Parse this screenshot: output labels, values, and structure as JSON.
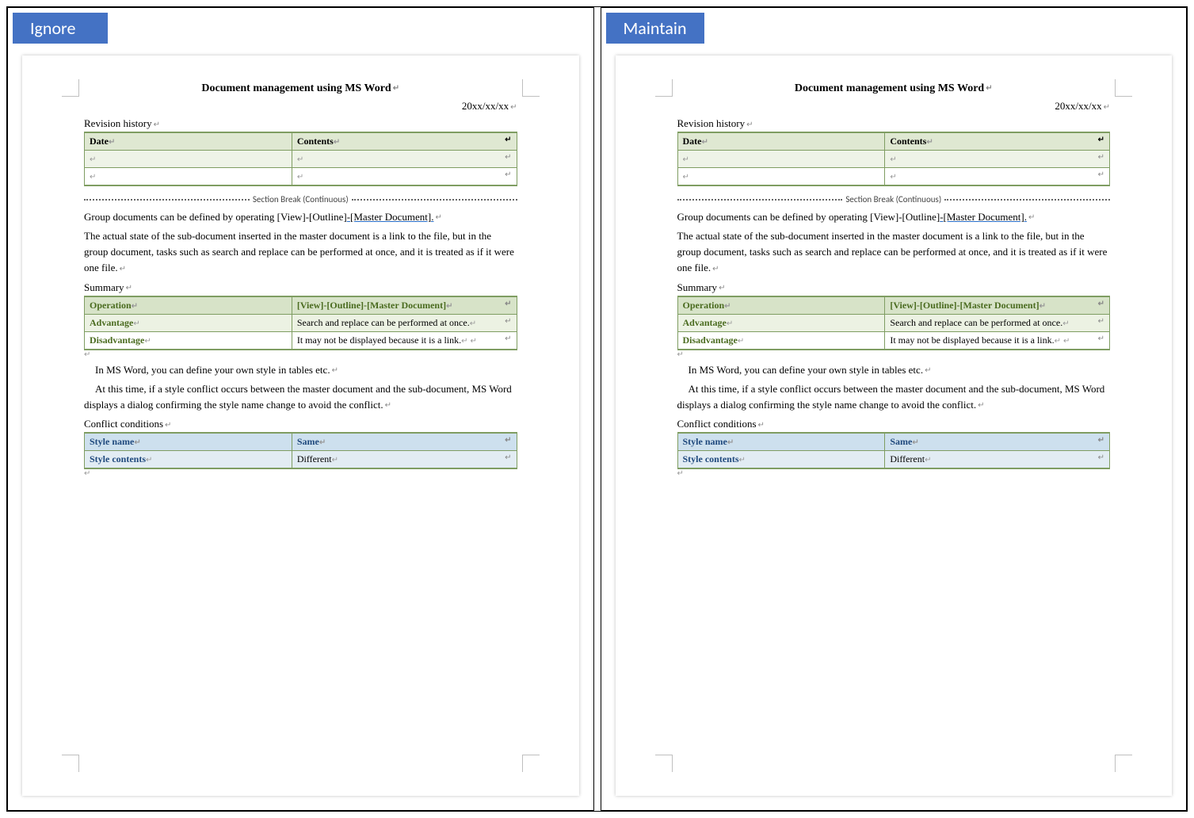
{
  "panes": {
    "left_label": "Ignore",
    "right_label": "Maintain"
  },
  "doc": {
    "title": "Document management using MS Word",
    "date": "20xx/xx/xx",
    "revision_history_label": "Revision history",
    "history_headers": {
      "date": "Date",
      "contents": "Contents"
    },
    "section_break": "Section Break (Continuous)",
    "para1_a": "Group documents can be defined by operating [View]-[Outline]",
    "para1_b": "-[Master Document].",
    "para2": "The actual state of the sub-document inserted in the master document is a link to the file, but in the group document, tasks such as search and replace can be performed at once, and it is treated as if it were one file.",
    "summary_label": "Summary",
    "summary": {
      "operation_label": "Operation",
      "operation_value": "[View]-[Outline]-[Master Document]",
      "advantage_label": "Advantage",
      "advantage_value": "Search and replace can be performed at once.",
      "disadvantage_label": "Disadvantage",
      "disadvantage_value": "It may not be displayed because it is a link."
    },
    "para3": "In MS Word, you can define your own style in tables etc.",
    "para4": "At this time, if a style conflict occurs between the master document and the sub-document, MS Word displays a dialog confirming the style name change to avoid the conflict.",
    "conflict_label": "Conflict conditions",
    "conflict": {
      "name_label": "Style name",
      "name_value": "Same",
      "contents_label": "Style contents",
      "contents_value": "Different"
    }
  }
}
